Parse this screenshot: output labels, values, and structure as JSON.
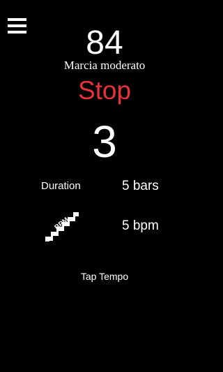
{
  "colors": {
    "background": "#000000",
    "text": "#ffffff",
    "stop": "#e8323a"
  },
  "menu": {
    "icon": "hamburger-menu-icon"
  },
  "tempo": {
    "value": "84",
    "marking": "Marcia moderato"
  },
  "control": {
    "stop_label": "Stop"
  },
  "beat": {
    "count": "3"
  },
  "duration": {
    "label": "Duration",
    "value": "5 bars"
  },
  "increment": {
    "icon": "bpm-stairs-icon",
    "icon_text": "BPM",
    "value": "5 bpm"
  },
  "tap": {
    "label": "Tap Tempo"
  }
}
